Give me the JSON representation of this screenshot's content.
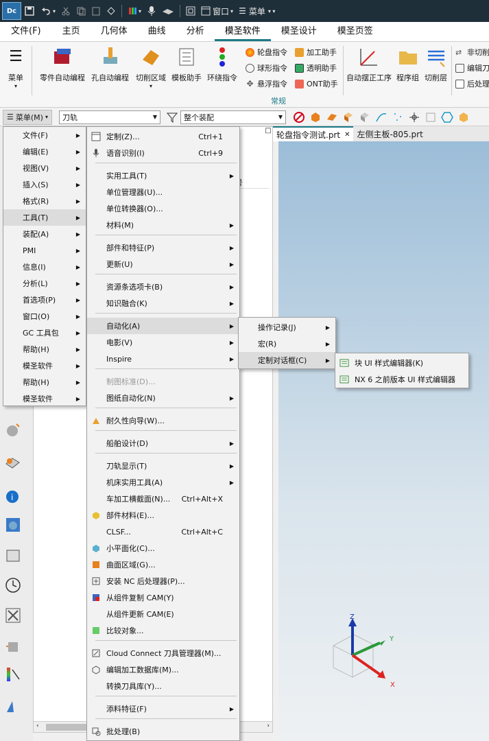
{
  "titlebar": {
    "logo": "Dc",
    "window_label": "窗口",
    "menu_label": "菜单"
  },
  "menubar": {
    "tabs": [
      "文件(F)",
      "主页",
      "几何体",
      "曲线",
      "分析",
      "模圣软件",
      "模圣设计",
      "模圣页签"
    ],
    "active": "模圣软件"
  },
  "ribbon": {
    "menu_label": "菜单",
    "buttons": [
      "零件自动编程",
      "孔自动编程",
      "切削区域",
      "模板助手",
      "环绕指令"
    ],
    "small": [
      "轮盘指令",
      "球形指令",
      "悬浮指令",
      "加工助手",
      "透明助手",
      "ONT助手"
    ],
    "right_buttons": [
      "自动摆正工序",
      "程序组",
      "切削层"
    ],
    "right_small": [
      "非切削",
      "编辑刀",
      "后处理"
    ],
    "group_label": "常规"
  },
  "toolbar2": {
    "menu_button": "菜单(M)",
    "filter_value": "刀轨",
    "assembly_value": "整个装配"
  },
  "navigator": {
    "column_header": "具号"
  },
  "file_tabs": [
    {
      "label": "轮盘指令测试.prt",
      "active": true
    },
    {
      "label": "左侧主板-805.prt",
      "active": false
    }
  ],
  "menu_level1": [
    "文件(F)",
    "编辑(E)",
    "视图(V)",
    "插入(S)",
    "格式(R)",
    "工具(T)",
    "装配(A)",
    "PMI",
    "信息(I)",
    "分析(L)",
    "首选项(P)",
    "窗口(O)",
    "GC 工具包",
    "帮助(H)",
    "模圣软件",
    "帮助(H)",
    "模圣软件"
  ],
  "menu_tools": [
    {
      "label": "定制(Z)...",
      "shortcut": "Ctrl+1"
    },
    {
      "label": "语音识别(I)",
      "shortcut": "Ctrl+9"
    },
    {
      "label": "实用工具(T)"
    },
    {
      "label": "单位管理器(U)..."
    },
    {
      "label": "单位转换器(O)..."
    },
    {
      "label": "材料(M)"
    },
    {
      "label": "部件和特征(P)"
    },
    {
      "label": "更新(U)"
    },
    {
      "label": "资源条选项卡(B)"
    },
    {
      "label": "知识融合(K)"
    },
    {
      "label": "自动化(A)"
    },
    {
      "label": "电影(V)"
    },
    {
      "label": "Inspire"
    },
    {
      "label": "制图标准(D)..."
    },
    {
      "label": "图纸自动化(N)"
    },
    {
      "label": "耐久性向导(W)..."
    },
    {
      "label": "船舶设计(D)"
    },
    {
      "label": "刀轨显示(T)"
    },
    {
      "label": "机床实用工具(A)"
    },
    {
      "label": "车加工横截面(N)...",
      "shortcut": "Ctrl+Alt+X"
    },
    {
      "label": "部件材料(E)..."
    },
    {
      "label": "CLSF...",
      "shortcut": "Ctrl+Alt+C"
    },
    {
      "label": "小平面化(C)..."
    },
    {
      "label": "曲面区域(G)..."
    },
    {
      "label": "安装 NC 后处理器(P)..."
    },
    {
      "label": "从组件复制 CAM(Y)"
    },
    {
      "label": "从组件更新 CAM(E)"
    },
    {
      "label": "比较对象..."
    },
    {
      "label": "Cloud Connect 刀具管理器(M)..."
    },
    {
      "label": "编辑加工数据库(M)..."
    },
    {
      "label": "转换刀具库(Y)..."
    },
    {
      "label": "添料特征(F)"
    },
    {
      "label": "批处理(B)"
    }
  ],
  "menu_automation": [
    "操作记录(J)",
    "宏(R)",
    "定制对话框(C)"
  ],
  "menu_dialog": [
    "块 UI 样式编辑器(K)",
    "NX 6 之前版本 UI 样式编辑器"
  ],
  "triad": {
    "x": "X",
    "y": "Y",
    "z": "Z"
  },
  "colors": {
    "accent": "#1a7a86",
    "titlebar": "#1f2f3a",
    "stop": "#d0021b"
  }
}
